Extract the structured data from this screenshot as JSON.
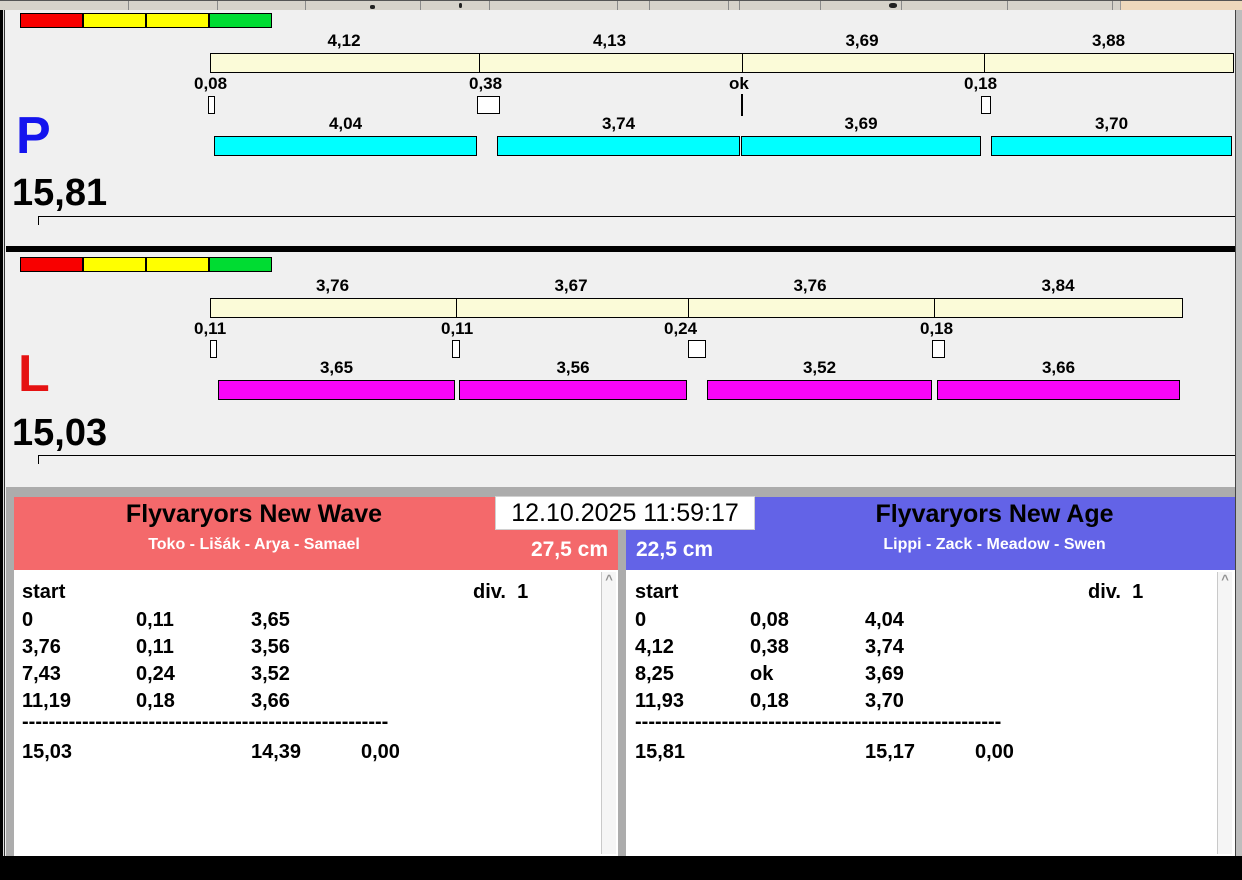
{
  "window": {
    "clock": "12.10.2025 11:59:17",
    "colors": {
      "panel_bg": "#F0F0F0",
      "chrome_gray": "#ACACAC",
      "split_bar": "#FBFBD8",
      "right_lane_bar": "#00FFFF",
      "left_lane_bar": "#F705F7",
      "traffic_lights": [
        "#F80000",
        "#FFFF00",
        "#FFFF00",
        "#00DC32"
      ],
      "team_left_header": "#F4696B",
      "team_right_header": "#6363E7",
      "p_letter": "#1414EE",
      "l_letter": "#E51212"
    }
  },
  "lanes": [
    {
      "letter": "P",
      "total": "15,81",
      "splits": [
        "4,12",
        "4,13",
        "3,69",
        "3,88"
      ],
      "exchanges": [
        "0,08",
        "0,38",
        "ok",
        "0,18"
      ],
      "runs": [
        "4,04",
        "3,74",
        "3,69",
        "3,70"
      ]
    },
    {
      "letter": "L",
      "total": "15,03",
      "splits": [
        "3,76",
        "3,67",
        "3,76",
        "3,84"
      ],
      "exchanges": [
        "0,11",
        "0,11",
        "0,24",
        "0,18"
      ],
      "runs": [
        "3,65",
        "3,56",
        "3,52",
        "3,66"
      ]
    }
  ],
  "teams": [
    {
      "name": "Flyvaryors New Wave",
      "lineup": "Toko - Lišák - Arya - Samael",
      "jump_height": "27,5 cm",
      "log": {
        "start_label": "start",
        "division_label": "div.  1",
        "rows": [
          {
            "t": "0",
            "gap": "0,11",
            "run": "3,65"
          },
          {
            "t": "3,76",
            "gap": "0,11",
            "run": "3,56"
          },
          {
            "t": "7,43",
            "gap": "0,24",
            "run": "3,52"
          },
          {
            "t": "11,19",
            "gap": "0,18",
            "run": "3,66"
          }
        ],
        "separator": "-------------------------------------------------------",
        "total_time": "15,03",
        "clean_time": "14,39",
        "penalty": "0,00"
      }
    },
    {
      "name": "Flyvaryors New Age",
      "lineup": "Lippi - Zack - Meadow - Swen",
      "jump_height": "22,5 cm",
      "log": {
        "start_label": "start",
        "division_label": "div.  1",
        "rows": [
          {
            "t": "0",
            "gap": "0,08",
            "run": "4,04"
          },
          {
            "t": "4,12",
            "gap": "0,38",
            "run": "3,74"
          },
          {
            "t": "8,25",
            "gap": "ok",
            "run": "3,69"
          },
          {
            "t": "11,93",
            "gap": "0,18",
            "run": "3,70"
          }
        ],
        "separator": "-------------------------------------------------------",
        "total_time": "15,81",
        "clean_time": "15,17",
        "penalty": "0,00"
      }
    }
  ],
  "scrollbar": {
    "up_arrow": "^"
  }
}
